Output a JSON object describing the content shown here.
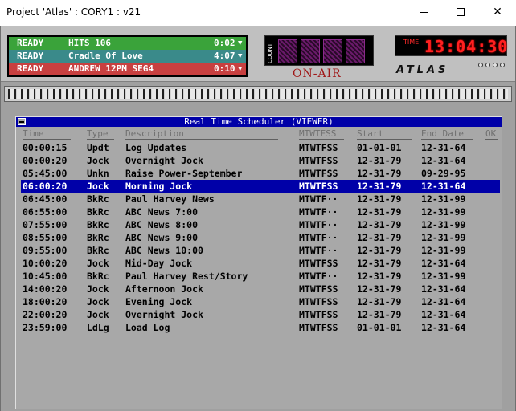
{
  "window": {
    "title": "Project 'Atlas' : CORY1 : v21"
  },
  "players": [
    {
      "status": "READY",
      "name": "HITS 106",
      "time": "0:02"
    },
    {
      "status": "READY",
      "name": "Cradle Of Love",
      "time": "4:07"
    },
    {
      "status": "READY",
      "name": "ANDREW 12PM SEG4",
      "time": "0:10"
    }
  ],
  "counter": {
    "label": "COUNT",
    "on_air": "ON-AIR"
  },
  "clock": {
    "label": "TIME",
    "value": "13:04:30"
  },
  "logo": "ATLAS",
  "scheduler": {
    "title": "Real Time Scheduler (VIEWER)",
    "columns": {
      "time": "Time",
      "type": "Type",
      "description": "Description",
      "days": "MTWTFSS",
      "start": "Start",
      "end": "End Date",
      "ok": "OK"
    },
    "rows": [
      {
        "time": "00:00:15",
        "type": "Updt",
        "description": "Log Updates",
        "days": "MTWTFSS",
        "start": "01-01-01",
        "end": "12-31-64"
      },
      {
        "time": "00:00:20",
        "type": "Jock",
        "description": "Overnight Jock",
        "days": "MTWTFSS",
        "start": "12-31-79",
        "end": "12-31-64"
      },
      {
        "time": "05:45:00",
        "type": "Unkn",
        "description": "Raise Power-September",
        "days": "MTWTFSS",
        "start": "12-31-79",
        "end": "09-29-95"
      },
      {
        "time": "06:00:20",
        "type": "Jock",
        "description": "Morning Jock",
        "days": "MTWTFSS",
        "start": "12-31-79",
        "end": "12-31-64"
      },
      {
        "time": "06:45:00",
        "type": "BkRc",
        "description": "Paul Harvey News",
        "days": "MTWTF··",
        "start": "12-31-79",
        "end": "12-31-99"
      },
      {
        "time": "06:55:00",
        "type": "BkRc",
        "description": "ABC News 7:00",
        "days": "MTWTF··",
        "start": "12-31-79",
        "end": "12-31-99"
      },
      {
        "time": "07:55:00",
        "type": "BkRc",
        "description": "ABC News 8:00",
        "days": "MTWTF··",
        "start": "12-31-79",
        "end": "12-31-99"
      },
      {
        "time": "08:55:00",
        "type": "BkRc",
        "description": "ABC News 9:00",
        "days": "MTWTF··",
        "start": "12-31-79",
        "end": "12-31-99"
      },
      {
        "time": "09:55:00",
        "type": "BkRc",
        "description": "ABC News 10:00",
        "days": "MTWTF··",
        "start": "12-31-79",
        "end": "12-31-99"
      },
      {
        "time": "10:00:20",
        "type": "Jock",
        "description": "Mid-Day Jock",
        "days": "MTWTFSS",
        "start": "12-31-79",
        "end": "12-31-64"
      },
      {
        "time": "10:45:00",
        "type": "BkRc",
        "description": "Paul Harvey Rest/Story",
        "days": "MTWTF··",
        "start": "12-31-79",
        "end": "12-31-99"
      },
      {
        "time": "14:00:20",
        "type": "Jock",
        "description": "Afternoon Jock",
        "days": "MTWTFSS",
        "start": "12-31-79",
        "end": "12-31-64"
      },
      {
        "time": "18:00:20",
        "type": "Jock",
        "description": "Evening Jock",
        "days": "MTWTFSS",
        "start": "12-31-79",
        "end": "12-31-64"
      },
      {
        "time": "22:00:20",
        "type": "Jock",
        "description": "Overnight Jock",
        "days": "MTWTFSS",
        "start": "12-31-79",
        "end": "12-31-64"
      },
      {
        "time": "23:59:00",
        "type": "LdLg",
        "description": "Load Log",
        "days": "MTWTFSS",
        "start": "01-01-01",
        "end": "12-31-64"
      }
    ]
  }
}
